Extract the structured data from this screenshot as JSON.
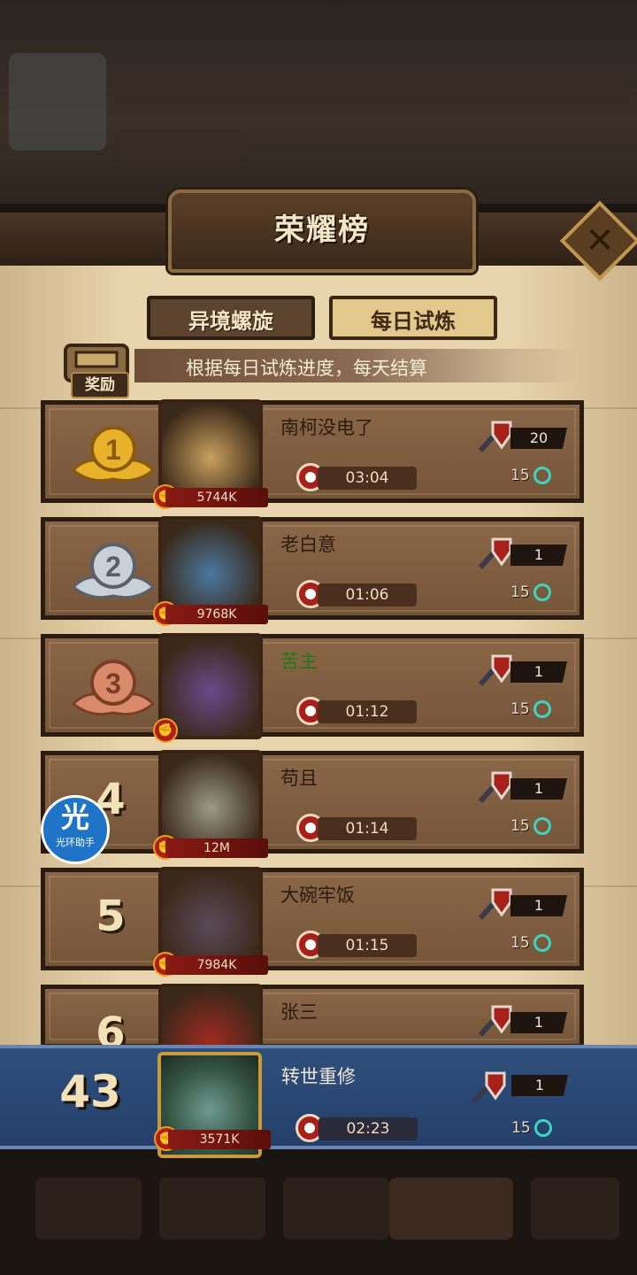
{
  "header": {
    "title": "荣耀榜",
    "close_icon": "close-icon"
  },
  "tabs": [
    {
      "label": "异境螺旋",
      "active": false
    },
    {
      "label": "每日试炼",
      "active": true
    }
  ],
  "reward": {
    "label": "奖励",
    "description": "根据每日试炼进度，每天结算"
  },
  "rows": [
    {
      "rank": "1",
      "name": "南柯没电了",
      "power": "5744K",
      "time": "03:04",
      "count": "20",
      "keys": "15",
      "name_green": false
    },
    {
      "rank": "2",
      "name": "老白意",
      "power": "9768K",
      "time": "01:06",
      "count": "1",
      "keys": "15",
      "name_green": false
    },
    {
      "rank": "3",
      "name": "苦主",
      "power": "",
      "time": "01:12",
      "count": "1",
      "keys": "15",
      "name_green": true
    },
    {
      "rank": "4",
      "name": "苟且",
      "power": "12M",
      "time": "01:14",
      "count": "1",
      "keys": "15",
      "name_green": false
    },
    {
      "rank": "5",
      "name": "大碗牢饭",
      "power": "7984K",
      "time": "01:15",
      "count": "1",
      "keys": "15",
      "name_green": false
    },
    {
      "rank": "6",
      "name": "张三",
      "power": "",
      "time": "",
      "count": "1",
      "keys": "",
      "name_green": false
    }
  ],
  "me": {
    "rank": "43",
    "name": "转世重修",
    "power": "3571K",
    "time": "02:23",
    "count": "1",
    "keys": "15"
  },
  "overlay_badge": {
    "glyph": "光",
    "label": "光环助手"
  },
  "colors": {
    "accent_green": "#1f7a1a",
    "self_row_blue": "#2f4f7c",
    "key_teal": "#3ed2c0"
  }
}
